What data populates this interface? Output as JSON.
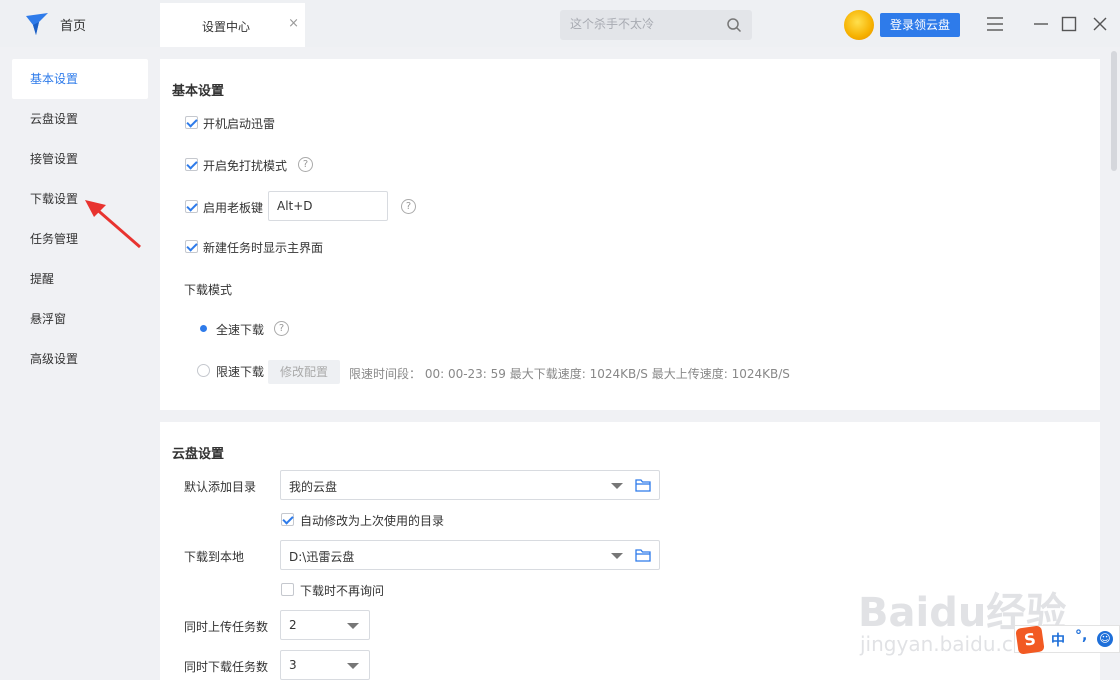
{
  "titlebar": {
    "home_label": "首页",
    "tab_label": "设置中心",
    "tab_close": "×",
    "search_placeholder": "这个杀手不太冷",
    "login_label": "登录领云盘"
  },
  "sidebar": {
    "items": [
      {
        "label": "基本设置",
        "active": true
      },
      {
        "label": "云盘设置"
      },
      {
        "label": "接管设置"
      },
      {
        "label": "下载设置"
      },
      {
        "label": "任务管理"
      },
      {
        "label": "提醒"
      },
      {
        "label": "悬浮窗"
      },
      {
        "label": "高级设置"
      }
    ]
  },
  "basic": {
    "title": "基本设置",
    "startup": {
      "label": "开机启动迅雷",
      "checked": true
    },
    "dnd": {
      "label": "开启免打扰模式",
      "checked": true
    },
    "boss_key": {
      "label": "启用老板键",
      "checked": true,
      "value": "Alt+D"
    },
    "show_main": {
      "label": "新建任务时显示主界面",
      "checked": true
    },
    "mode_title": "下载模式",
    "full_speed": {
      "label": "全速下载",
      "selected": true
    },
    "limit_speed": {
      "label": "限速下载",
      "selected": false
    },
    "modify_label": "修改配置",
    "limit_info": "限速时间段： 00: 00-23: 59   最大下载速度: 1024KB/S   最大上传速度: 1024KB/S"
  },
  "cloud": {
    "title": "云盘设置",
    "default_dir_label": "默认添加目录",
    "default_dir_value": "我的云盘",
    "auto_modify": {
      "label": "自动修改为上次使用的目录",
      "checked": true
    },
    "local_label": "下载到本地",
    "local_value": "D:\\迅雷云盘",
    "no_ask": {
      "label": "下载时不再询问",
      "checked": false
    },
    "upload_label": "同时上传任务数",
    "upload_value": "2",
    "download_label": "同时下载任务数",
    "download_value": "3"
  },
  "watermark": {
    "brand": "Baidu经验",
    "url": "jingyan.baidu.com"
  },
  "ime": {
    "logo": "S",
    "lang": "中",
    "punct": "°,",
    "emoji": "☺"
  },
  "colors": {
    "accent": "#2e7bea",
    "panel_bg": "#ffffff",
    "app_bg": "#f0f1f4"
  }
}
